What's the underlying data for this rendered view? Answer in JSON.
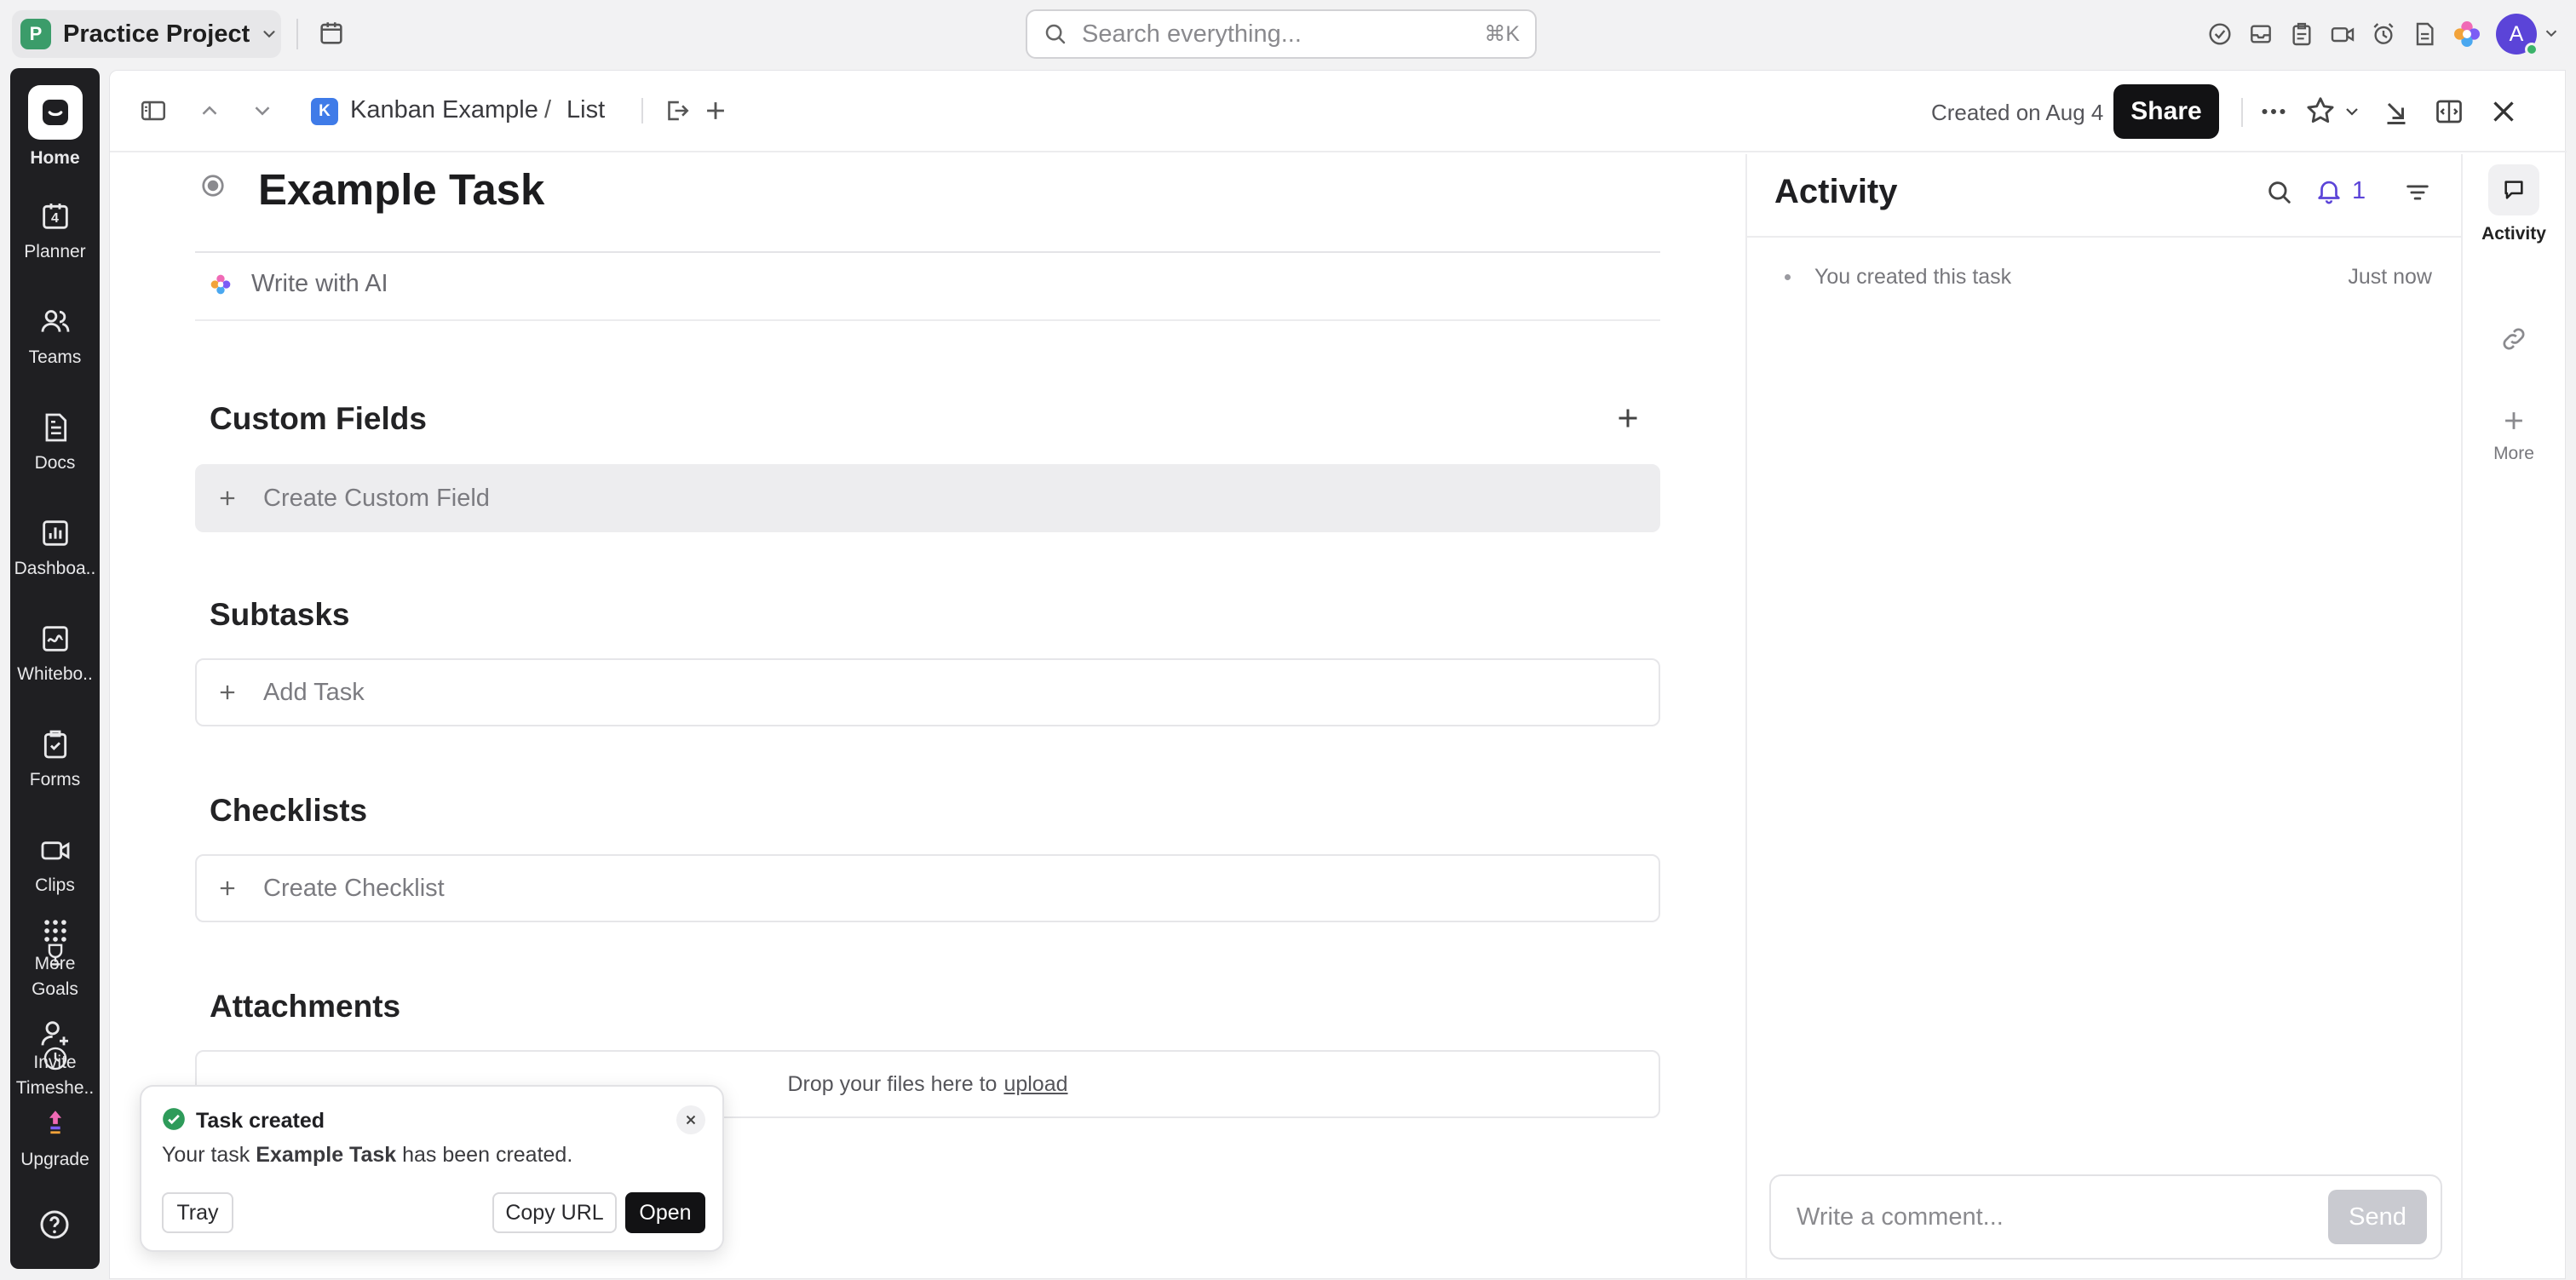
{
  "workspace": {
    "badge": "P",
    "name": "Practice Project"
  },
  "search": {
    "placeholder": "Search everything...",
    "shortcut": "⌘K"
  },
  "user": {
    "avatar": "A"
  },
  "sidebar": {
    "items": [
      {
        "label": "Home",
        "icon": "home-icon"
      },
      {
        "label": "Planner",
        "icon": "calendar-icon",
        "badge": "4"
      },
      {
        "label": "Teams",
        "icon": "teams-icon"
      },
      {
        "label": "Docs",
        "icon": "docs-icon"
      },
      {
        "label": "Dashboa..",
        "icon": "dashboard-icon"
      },
      {
        "label": "Whitebo..",
        "icon": "whiteboard-icon"
      },
      {
        "label": "Forms",
        "icon": "forms-icon"
      },
      {
        "label": "Clips",
        "icon": "clips-icon"
      },
      {
        "label": "More",
        "icon": "grid-icon"
      },
      {
        "label": "Goals",
        "icon": "trophy-icon"
      },
      {
        "label": "Invite",
        "icon": "invite-icon"
      },
      {
        "label": "Timeshe..",
        "icon": "clock-icon"
      },
      {
        "label": "Upgrade",
        "icon": "upgrade-icon"
      }
    ]
  },
  "breadcrumb": {
    "space_badge": "K",
    "space": "Kanban Example",
    "separator": "/",
    "list": "List"
  },
  "header": {
    "created": "Created on Aug 4",
    "share_label": "Share"
  },
  "task": {
    "title": "Example Task",
    "ai_label": "Write with AI",
    "custom_fields": {
      "heading": "Custom Fields",
      "create_label": "Create Custom Field"
    },
    "subtasks": {
      "heading": "Subtasks",
      "add_label": "Add Task"
    },
    "checklists": {
      "heading": "Checklists",
      "create_label": "Create Checklist"
    },
    "attachments": {
      "heading": "Attachments",
      "drop_text": "Drop your files here to",
      "upload_link": "upload"
    }
  },
  "activity": {
    "heading": "Activity",
    "notification_count": "1",
    "entries": [
      {
        "text": "You created this task",
        "time": "Just now"
      }
    ],
    "comment_placeholder": "Write a comment...",
    "send_label": "Send"
  },
  "rail": {
    "activity_label": "Activity",
    "more_label": "More"
  },
  "toast": {
    "title": "Task created",
    "message_prefix": "Your task",
    "task_name": "Example Task",
    "message_suffix": "has been created.",
    "tray_label": "Tray",
    "copy_url_label": "Copy URL",
    "open_label": "Open"
  },
  "colors": {
    "accent": "#7b5cf5",
    "workspace_badge": "#3b9c6a",
    "space_badge": "#3f7be8",
    "success": "#2e9b5a"
  }
}
